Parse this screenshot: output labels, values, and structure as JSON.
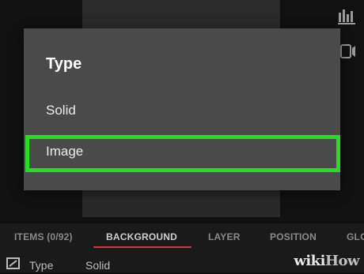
{
  "dialog": {
    "title": "Type",
    "options": [
      {
        "label": "Solid",
        "selected": false
      },
      {
        "label": "Image",
        "selected": true
      }
    ]
  },
  "tabs": [
    {
      "label": "ITEMS (0/92)",
      "active": false
    },
    {
      "label": "BACKGROUND",
      "active": true
    },
    {
      "label": "LAYER",
      "active": false
    },
    {
      "label": "POSITION",
      "active": false
    },
    {
      "label": "GLO",
      "active": false
    }
  ],
  "property": {
    "icon": "image-edit-icon",
    "label": "Type",
    "value": "Solid"
  },
  "watermark": {
    "text_part1": "wiki",
    "text_part2": "How"
  },
  "icons": {
    "top_right": "waveform-icon",
    "right_middle": "aspect-ratio-icon"
  },
  "colors": {
    "dialog_bg": "#4a4a4a",
    "highlight": "#22e021",
    "tab_underline": "#d0383a",
    "app_bg": "#111111"
  }
}
